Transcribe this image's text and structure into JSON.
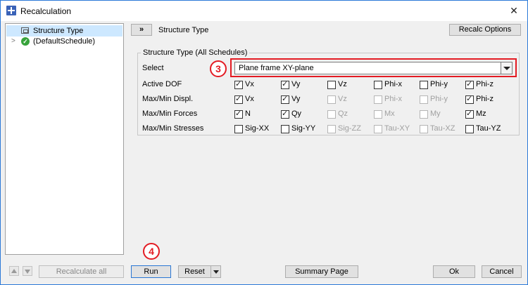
{
  "window": {
    "title": "Recalculation",
    "close_glyph": "✕"
  },
  "tree": {
    "items": [
      {
        "label": "Structure Type",
        "selected": true,
        "icon": "structure-icon"
      },
      {
        "label": "(DefaultSchedule)",
        "selected": false,
        "icon": "check-circle-icon",
        "status_color": "#37a33b"
      }
    ]
  },
  "header": {
    "expand_label": "»",
    "title": "Structure Type",
    "recalc_options_label": "Recalc Options"
  },
  "group": {
    "legend": "Structure Type (All Schedules)",
    "select_label": "Select",
    "select_value": "Plane frame XY-plane",
    "rows": [
      {
        "label": "Active DOF",
        "items": [
          {
            "label": "Vx",
            "checked": true,
            "disabled": false
          },
          {
            "label": "Vy",
            "checked": true,
            "disabled": false
          },
          {
            "label": "Vz",
            "checked": false,
            "disabled": false
          },
          {
            "label": "Phi-x",
            "checked": false,
            "disabled": false
          },
          {
            "label": "Phi-y",
            "checked": false,
            "disabled": false
          },
          {
            "label": "Phi-z",
            "checked": true,
            "disabled": false
          }
        ]
      },
      {
        "label": "Max/Min Displ.",
        "items": [
          {
            "label": "Vx",
            "checked": true,
            "disabled": false
          },
          {
            "label": "Vy",
            "checked": true,
            "disabled": false
          },
          {
            "label": "Vz",
            "checked": false,
            "disabled": true
          },
          {
            "label": "Phi-x",
            "checked": false,
            "disabled": true
          },
          {
            "label": "Phi-y",
            "checked": false,
            "disabled": true
          },
          {
            "label": "Phi-z",
            "checked": true,
            "disabled": false
          }
        ]
      },
      {
        "label": "Max/Min Forces",
        "items": [
          {
            "label": "N",
            "checked": true,
            "disabled": false
          },
          {
            "label": "Qy",
            "checked": true,
            "disabled": false
          },
          {
            "label": "Qz",
            "checked": false,
            "disabled": true
          },
          {
            "label": "Mx",
            "checked": false,
            "disabled": true
          },
          {
            "label": "My",
            "checked": false,
            "disabled": true
          },
          {
            "label": "Mz",
            "checked": true,
            "disabled": false
          }
        ]
      },
      {
        "label": "Max/Min Stresses",
        "items": [
          {
            "label": "Sig-XX",
            "checked": false,
            "disabled": false
          },
          {
            "label": "Sig-YY",
            "checked": false,
            "disabled": false
          },
          {
            "label": "Sig-ZZ",
            "checked": false,
            "disabled": true
          },
          {
            "label": "Tau-XY",
            "checked": false,
            "disabled": true
          },
          {
            "label": "Tau-XZ",
            "checked": false,
            "disabled": true
          },
          {
            "label": "Tau-YZ",
            "checked": false,
            "disabled": false
          }
        ]
      }
    ]
  },
  "annotations": {
    "marker_select": "3",
    "marker_run": "4",
    "color": "#e31b23"
  },
  "footer": {
    "recalc_all_label": "Recalculate all",
    "run_label": "Run",
    "reset_label": "Reset",
    "summary_label": "Summary Page",
    "ok_label": "Ok",
    "cancel_label": "Cancel"
  }
}
